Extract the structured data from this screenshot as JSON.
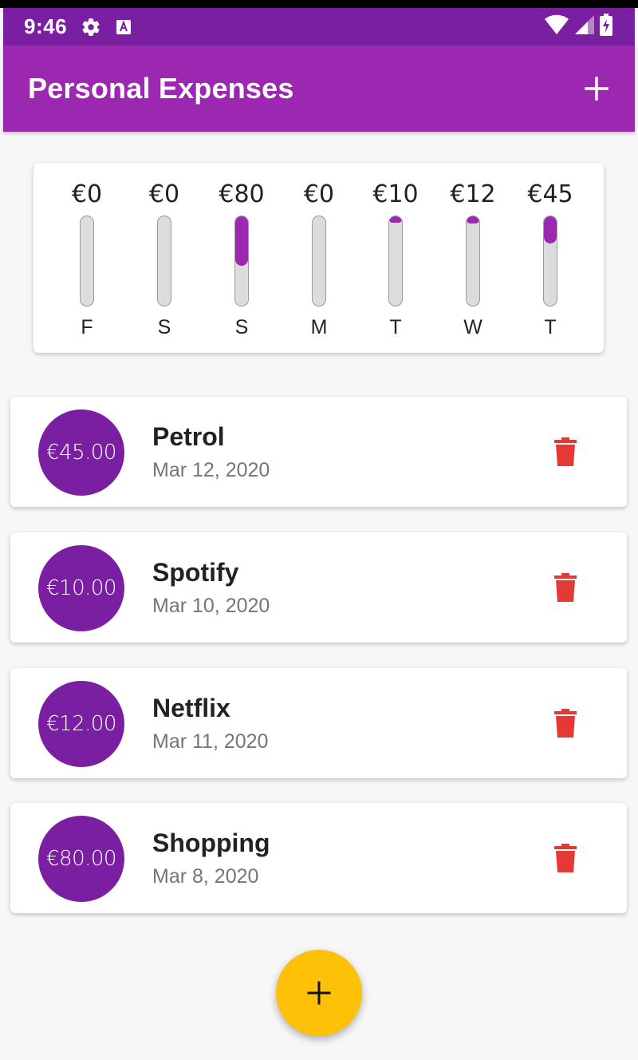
{
  "status_bar": {
    "time": "9:46",
    "icons": [
      "gear-icon",
      "a-icon",
      "wifi-icon",
      "signal-icon",
      "battery-charging-icon"
    ]
  },
  "app_bar": {
    "title": "Personal Expenses",
    "add_icon": "plus-icon"
  },
  "colors": {
    "primary": "#9c27b0",
    "primary_dark": "#7b1fa2",
    "accent": "#ffc107",
    "delete": "#e53935"
  },
  "chart_data": {
    "type": "bar",
    "categories": [
      "F",
      "S",
      "S",
      "M",
      "T",
      "W",
      "T"
    ],
    "labels": [
      "€0",
      "€0",
      "€80",
      "€0",
      "€10",
      "€12",
      "€45"
    ],
    "values": [
      0,
      0,
      80,
      0,
      10,
      12,
      45
    ],
    "fill_fraction": [
      0,
      0,
      0.54,
      0,
      0.07,
      0.08,
      0.3
    ]
  },
  "transactions": [
    {
      "amount": "€45.00",
      "title": "Petrol",
      "date": "Mar 12, 2020"
    },
    {
      "amount": "€10.00",
      "title": "Spotify",
      "date": "Mar 10, 2020"
    },
    {
      "amount": "€12.00",
      "title": "Netflix",
      "date": "Mar 11, 2020"
    },
    {
      "amount": "€80.00",
      "title": "Shopping",
      "date": "Mar 8, 2020"
    }
  ],
  "fab": {
    "icon": "plus-icon"
  }
}
